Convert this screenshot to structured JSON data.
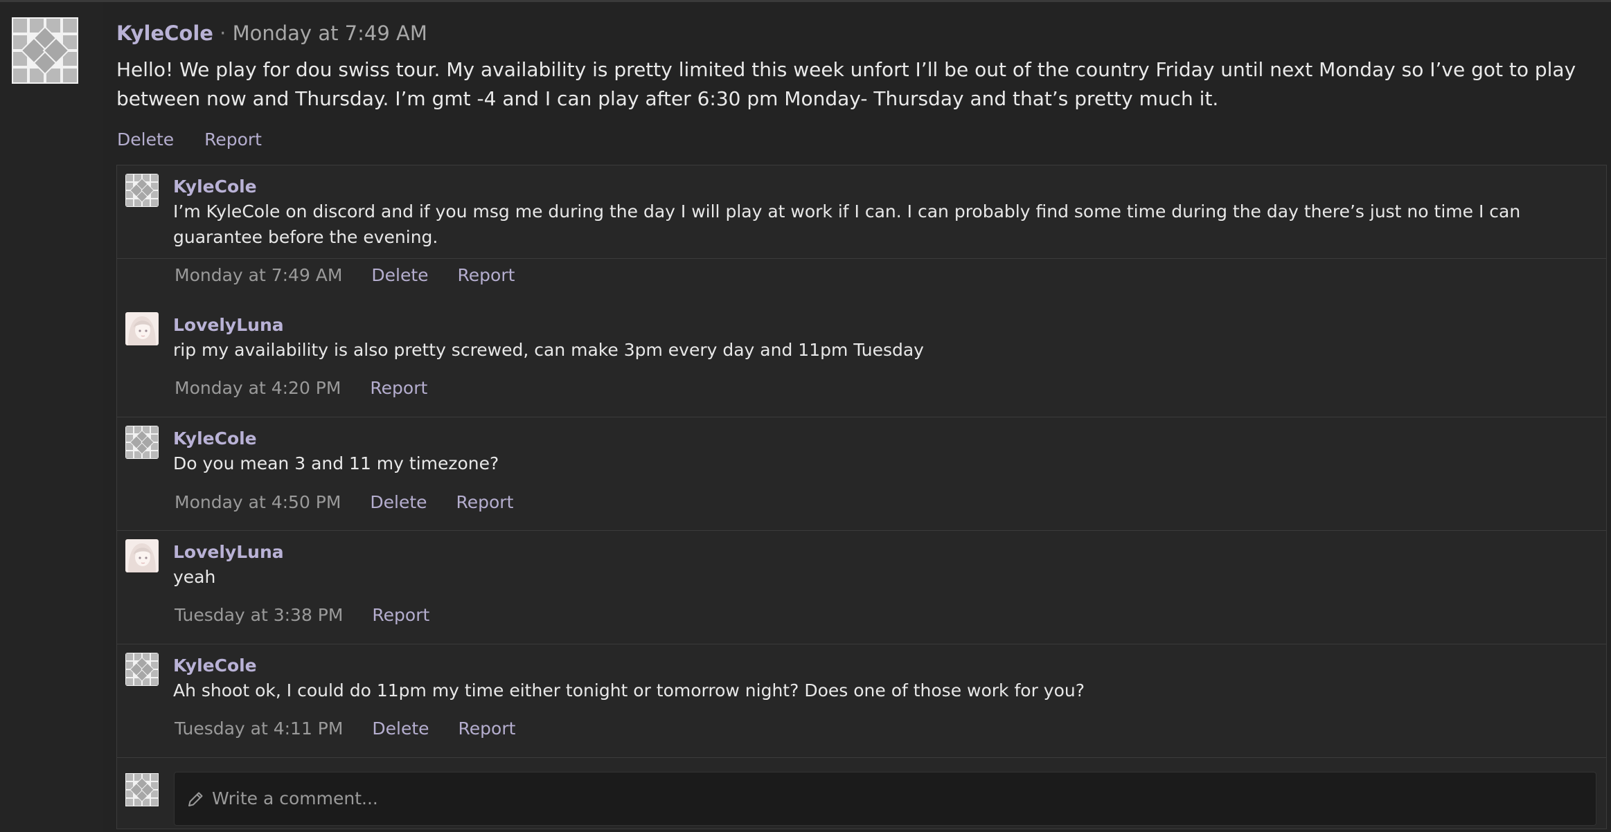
{
  "post": {
    "author": "KyleCole",
    "separator": "·",
    "timestamp": "Monday at 7:49 AM",
    "body": "Hello! We play for dou swiss tour. My availability is pretty limited this week unfort I’ll be out of the country Friday until next Monday so I’ve got to play between now and Thursday. I’m gmt -4 and I can play after 6:30 pm Monday- Thursday and that’s pretty much it.",
    "actions": {
      "delete": "Delete",
      "report": "Report"
    }
  },
  "comments": [
    {
      "author": "KyleCole",
      "text": "I’m KyleCole on discord and if you msg me during the day I will play at work if I can. I can probably find some time during the day there’s just no time I can guarantee before the evening.",
      "timestamp": "Monday at 7:49 AM",
      "delete": "Delete",
      "report": "Report"
    },
    {
      "author": "LovelyLuna",
      "text": "rip my availability is also pretty screwed, can make 3pm every day and 11pm Tuesday",
      "timestamp": "Monday at 4:20 PM",
      "report": "Report"
    },
    {
      "author": "KyleCole",
      "text": "Do you mean 3 and 11 my timezone?",
      "timestamp": "Monday at 4:50 PM",
      "delete": "Delete",
      "report": "Report"
    },
    {
      "author": "LovelyLuna",
      "text": "yeah",
      "timestamp": "Tuesday at 3:38 PM",
      "report": "Report"
    },
    {
      "author": "KyleCole",
      "text": "Ah shoot ok, I could do 11pm my time either tonight or tomorrow night? Does one of those work for you?",
      "timestamp": "Tuesday at 4:11 PM",
      "delete": "Delete",
      "report": "Report"
    }
  ],
  "compose": {
    "placeholder": "Write a comment...",
    "icon": "pencil-icon"
  },
  "icons": {
    "kylecole_avatar": "tiled-diamond-avatar",
    "lovelyluna_avatar": "anime-portrait-avatar"
  },
  "colors": {
    "background": "#1f1f1f",
    "username": "#b9b2d6",
    "action_link": "#b5aecf",
    "timestamp": "#9a9a9a",
    "text": "#e8e8e8"
  }
}
